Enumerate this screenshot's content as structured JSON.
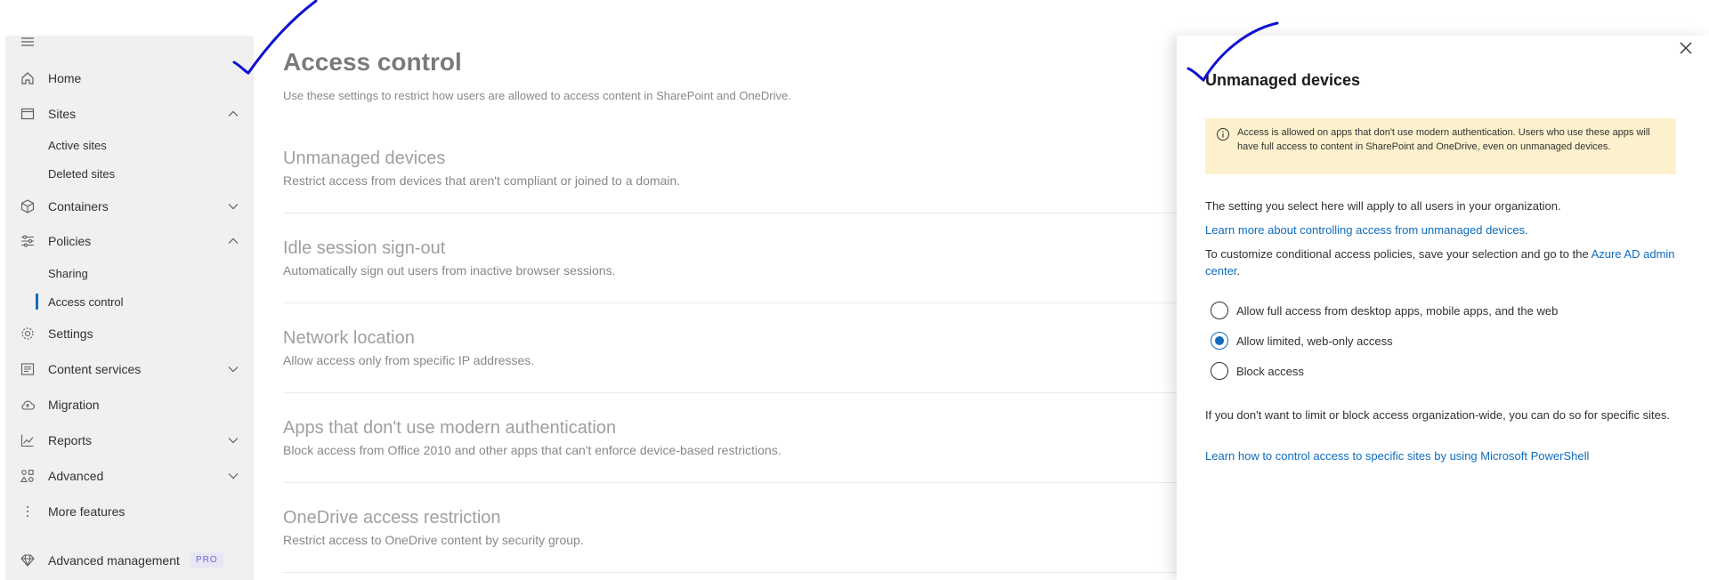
{
  "sidebar": {
    "menu_icon": "hamburger-icon",
    "items": [
      {
        "label": "Home",
        "icon": "home-icon"
      },
      {
        "label": "Sites",
        "icon": "sites-icon",
        "expanded": true
      },
      {
        "label": "Active sites"
      },
      {
        "label": "Deleted sites"
      },
      {
        "label": "Containers",
        "icon": "containers-icon",
        "expanded": false
      },
      {
        "label": "Policies",
        "icon": "policies-icon",
        "expanded": true
      },
      {
        "label": "Sharing"
      },
      {
        "label": "Access control",
        "active": true
      },
      {
        "label": "Settings",
        "icon": "gear-icon"
      },
      {
        "label": "Content services",
        "icon": "content-services-icon",
        "expanded": false
      },
      {
        "label": "Migration",
        "icon": "cloud-icon"
      },
      {
        "label": "Reports",
        "icon": "chart-icon",
        "expanded": false
      },
      {
        "label": "Advanced",
        "icon": "advanced-icon",
        "expanded": false
      },
      {
        "label": "More features",
        "icon": "more-icon"
      },
      {
        "label": "Advanced management",
        "icon": "diamond-icon",
        "badge": "PRO"
      }
    ]
  },
  "main": {
    "title": "Access control",
    "description": "Use these settings to restrict how users are allowed to access content in SharePoint and OneDrive.",
    "settings": [
      {
        "title": "Unmanaged devices",
        "description": "Restrict access from devices that aren't compliant or joined to a domain."
      },
      {
        "title": "Idle session sign-out",
        "description": "Automatically sign out users from inactive browser sessions."
      },
      {
        "title": "Network location",
        "description": "Allow access only from specific IP addresses."
      },
      {
        "title": "Apps that don't use modern authentication",
        "description": "Block access from Office 2010 and other apps that can't enforce device-based restrictions."
      },
      {
        "title": "OneDrive access restriction",
        "description": "Restrict access to OneDrive content by security group."
      }
    ]
  },
  "panel": {
    "title": "Unmanaged devices",
    "banner_text": "Access is allowed on apps that don't use modern authentication. Users who use these apps will have full access to content in SharePoint and OneDrive, even on unmanaged devices.",
    "p1": "The setting you select here will apply to all users in your organization.",
    "link1": "Learn more about controlling access from unmanaged devices.",
    "p2_before": "To customize conditional access policies, save your selection and go to the ",
    "p2_link": "Azure AD admin center",
    "p2_after": ".",
    "options": [
      {
        "label": "Allow full access from desktop apps, mobile apps, and the web",
        "checked": false
      },
      {
        "label": "Allow limited, web-only access",
        "checked": true
      },
      {
        "label": "Block access",
        "checked": false
      }
    ],
    "p3": "If you don't want to limit or block access organization-wide, you can do so for specific sites.",
    "link2": "Learn how to control access to specific sites by using Microsoft PowerShell"
  },
  "colors": {
    "accent": "#0f6cbd",
    "banner_bg": "#fdf1cd",
    "pen_ink": "#1010d0"
  }
}
